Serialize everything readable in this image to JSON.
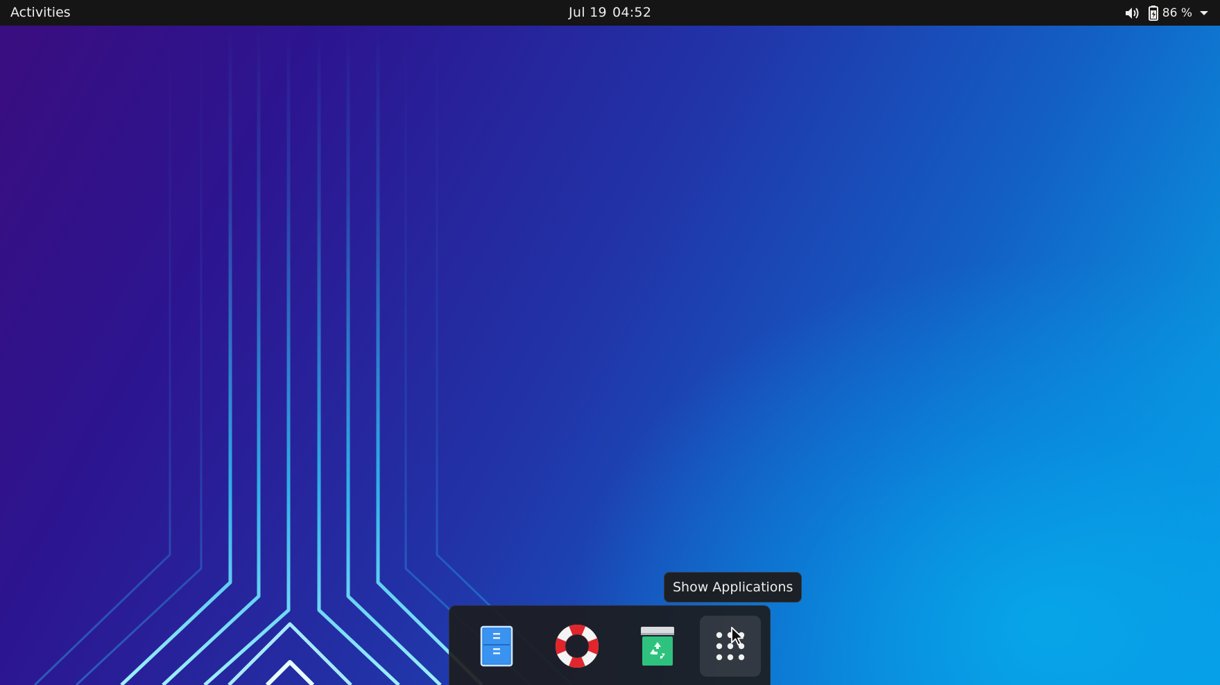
{
  "top_bar": {
    "activities_label": "Activities",
    "date": "Jul 19",
    "time": "04:52",
    "battery_percent": "86 %",
    "icons": [
      "speaker-icon",
      "battery-icon",
      "chevron-down-icon"
    ]
  },
  "dock": {
    "items": [
      {
        "name": "files",
        "icon": "files-icon"
      },
      {
        "name": "help",
        "icon": "lifebuoy-icon"
      },
      {
        "name": "trash",
        "icon": "trash-icon"
      },
      {
        "name": "show-applications",
        "icon": "app-grid-icon"
      }
    ]
  },
  "tooltip": {
    "text": "Show Applications"
  },
  "colors": {
    "top_bar_bg": "#151515",
    "dock_bg": "#1c1c1e",
    "wallpaper_purple": "#3a0d7f",
    "wallpaper_blue": "#07a4ea",
    "wallpaper_lines": "#2fd8ff"
  }
}
